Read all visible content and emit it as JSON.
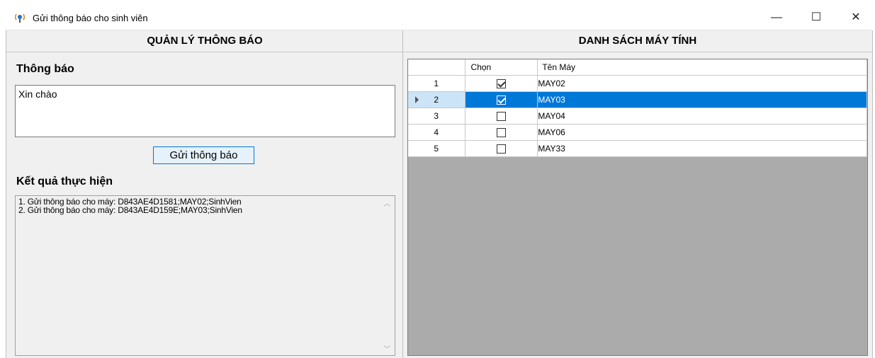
{
  "window": {
    "title": "Gửi thông báo cho sinh viên",
    "controls": {
      "minimize": "—",
      "maximize": "☐",
      "close": "✕"
    }
  },
  "left_panel": {
    "header": "QUẢN LÝ THÔNG BÁO",
    "message_label": "Thông báo",
    "message_value": "Xin chào",
    "send_button": "Gửi thông báo",
    "result_label": "Kết quả thực hiện",
    "log_lines": [
      "1. Gửi thông báo cho máy: D843AE4D1581;MAY02;SinhVien",
      "2. Gửi thông báo cho máy: D843AE4D159E;MAY03;SinhVien"
    ]
  },
  "right_panel": {
    "header": "DANH SÁCH MÁY TÍNH",
    "columns": [
      "",
      "Chọn",
      "Tên Máy"
    ],
    "rows": [
      {
        "index": "1",
        "checked": true,
        "name": "MAY02",
        "selected": false
      },
      {
        "index": "2",
        "checked": true,
        "name": "MAY03",
        "selected": true
      },
      {
        "index": "3",
        "checked": false,
        "name": "MAY04",
        "selected": false
      },
      {
        "index": "4",
        "checked": false,
        "name": "MAY06",
        "selected": false
      },
      {
        "index": "5",
        "checked": false,
        "name": "MAY33",
        "selected": false
      }
    ]
  },
  "colors": {
    "selection": "#0078d7",
    "panel_bg": "#f0f0f0",
    "grid_empty_bg": "#ababab"
  },
  "icons": {
    "app": "broadcast-icon"
  }
}
